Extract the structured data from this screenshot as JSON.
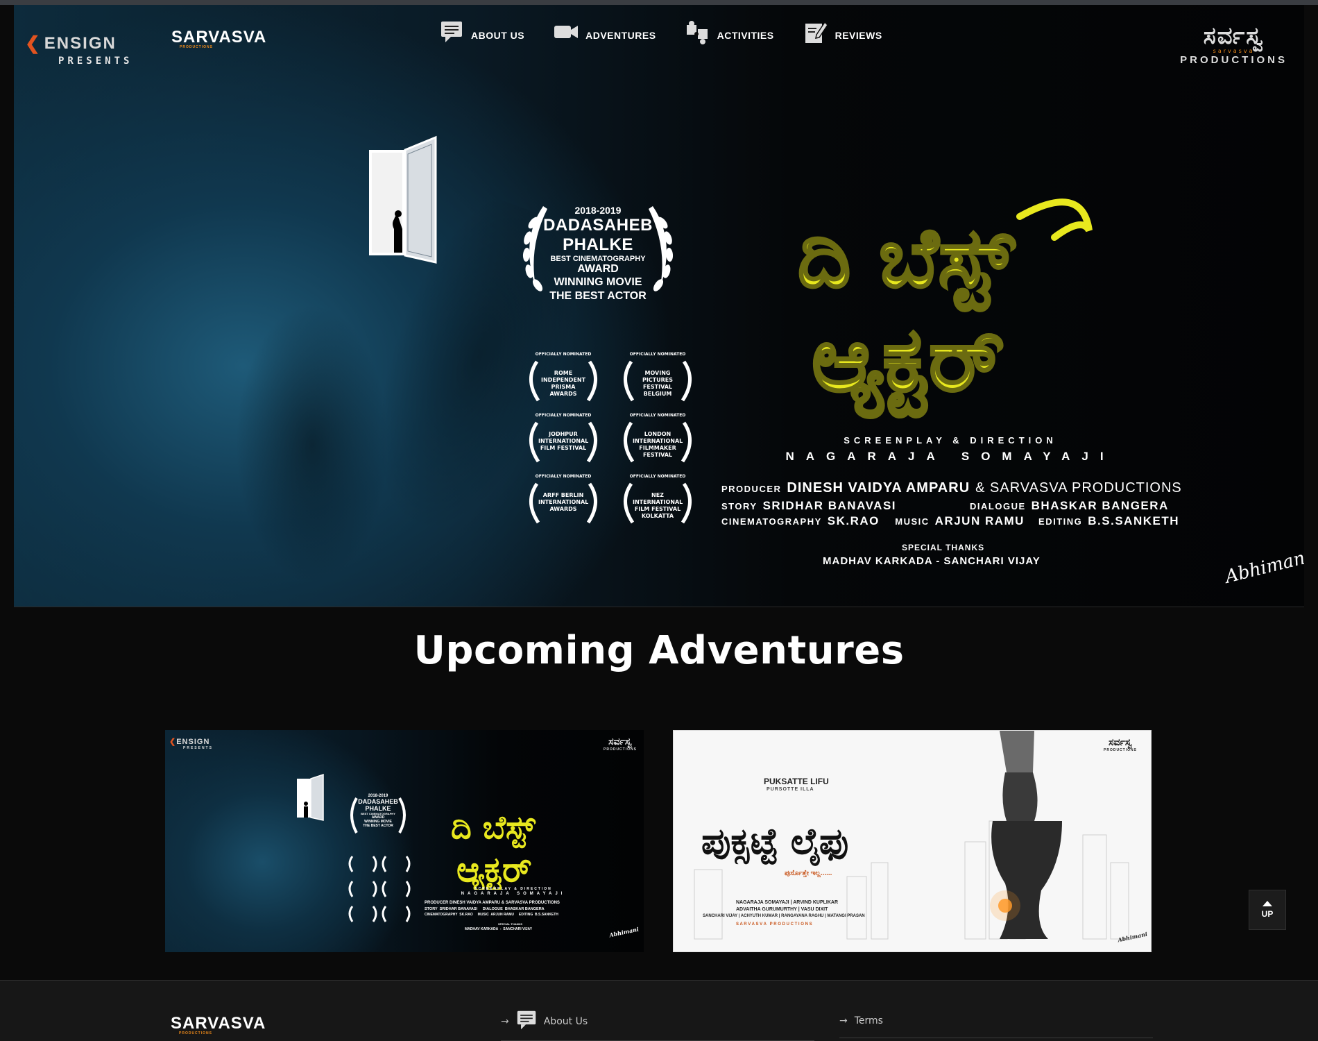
{
  "header": {
    "brand_left": {
      "word": "ENSIGN",
      "tagline": "PRESENTS"
    },
    "brand_sarvasva": "SARVASVA",
    "brand_sarvasva_sub": "PRODUCTIONS",
    "brand_right": {
      "kannada": "ಸರ್ವಸ್ವ",
      "latin": "sarvasva",
      "tagline": "PRODUCTIONS"
    },
    "nav": [
      {
        "label": "ABOUT US",
        "icon": "chat-icon"
      },
      {
        "label": "ADVENTURES",
        "icon": "video-camera-icon"
      },
      {
        "label": "ACTIVITIES",
        "icon": "puzzle-icon"
      },
      {
        "label": "REVIEWS",
        "icon": "edit-icon"
      }
    ]
  },
  "hero": {
    "award": {
      "years": "2018-2019",
      "line1": "DADASAHEB",
      "line2": "PHALKE",
      "line3": "BEST CINEMATOGRAPHY",
      "line4": "AWARD",
      "line5": "WINNING MOVIE",
      "line6": "THE BEST ACTOR"
    },
    "nominations_label": "OFFICIALLY NOMINATED",
    "nominations": [
      "ROME INDEPENDENT PRISMA AWARDS",
      "MOVING PICTURES FESTIVAL BELGIUM",
      "JODHPUR INTERNATIONAL FILM FESTIVAL",
      "LONDON INTERNATIONAL FILMMAKER FESTIVAL",
      "ARFF BERLIN INTERNATIONAL AWARDS",
      "NEZ INTERNATIONAL FILM FESTIVAL KOLKATTA"
    ],
    "title_kannada": "ದಿ ಬೆಸ್ಟ್ ಆ್ಯಕ್ಟರ್",
    "title_line1": "ದಿ ಬೆಸ್ಟ್",
    "title_line2": "ಆ್ಯಕ್ಟರ್",
    "credits": {
      "sd_label": "SCREENPLAY & DIRECTION",
      "sd_name": "NAGARAJA SOMAYAJI",
      "producer_label": "PRODUCER",
      "producer_name": "DINESH VAIDYA AMPARU",
      "producer_join": "& SARVASVA PRODUCTIONS",
      "story_label": "STORY",
      "story_name": "SRIDHAR BANAVASI",
      "dialogue_label": "DIALOGUE",
      "dialogue_name": "BHASKAR BANGERA",
      "cinematography_label": "CINEMATOGRAPHY",
      "cinematography_name": "SK.RAO",
      "music_label": "MUSIC",
      "music_name": "ARJUN RAMU",
      "editing_label": "EDITING",
      "editing_name": "B.S.SANKETH",
      "thanks_label": "SPECIAL THANKS",
      "thanks_names": "MADHAV KARKADA  -  SANCHARI VIJAY"
    },
    "signature": "Abhimani"
  },
  "upcoming": {
    "heading": "Upcoming Adventures",
    "card1": {
      "ensign": "ENSIGN",
      "presents": "PRESENTS",
      "productions": "PRODUCTIONS",
      "years": "2018-2019",
      "award1": "DADASAHEB",
      "award2": "PHALKE",
      "award3": "BEST CINEMATOGRAPHY",
      "award4": "AWARD",
      "award5": "WINNING MOVIE",
      "award6": "THE BEST ACTOR",
      "title_line1": "ದಿ ಬೆಸ್ಟ್",
      "title_line2": "ಆ್ಯಕ್ಟರ್",
      "sd_label": "SCREENPLAY & DIRECTION",
      "sd_name": "NAGARAJA SOMAYAJI",
      "producer_line": "PRODUCER  DINESH VAIDYA AMPARU & SARVASVA PRODUCTIONS",
      "story_line": "STORY  SRIDHAR BANAVASI     DIALOGUE  BHASKAR BANGERA",
      "cinema_line": "CINEMATOGRAPHY  SK.RAO     MUSIC  ARJUN RAMU     EDITING  B.S.SANKETH",
      "thanks_label": "SPECIAL THANKS",
      "thanks_names": "MADHAV KARKADA  -  SANCHARI VIJAY",
      "signature": "Abhimani"
    },
    "card2": {
      "title_en": "PUKSATTE LIFU",
      "subtitle_en": "PURSOTTE ILLA",
      "title_kannada": "ಪುಕ್ಸಟ್ಟೆ ಲೈಫು",
      "tagline_kannada": "ಪುರ್ಸೊತ್ತೇ ಇಲ್ಲ......",
      "crew1": "NAGARAJA SOMAYAJI  |  ARVIND KUPLIKAR",
      "crew2": "ADVAITHA GURUMURTHY  |  VASU DIXIT",
      "crew3": "SANCHARI VIJAY | ACHYUTH KUMAR | RANGAYANA RAGHU | MATANGI PRASAN",
      "crew4": "S A R V A S V A   P R O D U C T I O N S",
      "productions": "PRODUCTIONS",
      "signature": "Abhimani"
    }
  },
  "up_button": "UP",
  "footer": {
    "about": "About Us",
    "terms": "Terms"
  },
  "colors": {
    "title_yellow": "#e8e81e",
    "accent_orange": "#f28c1a",
    "ensign_orange": "#e2531f"
  }
}
